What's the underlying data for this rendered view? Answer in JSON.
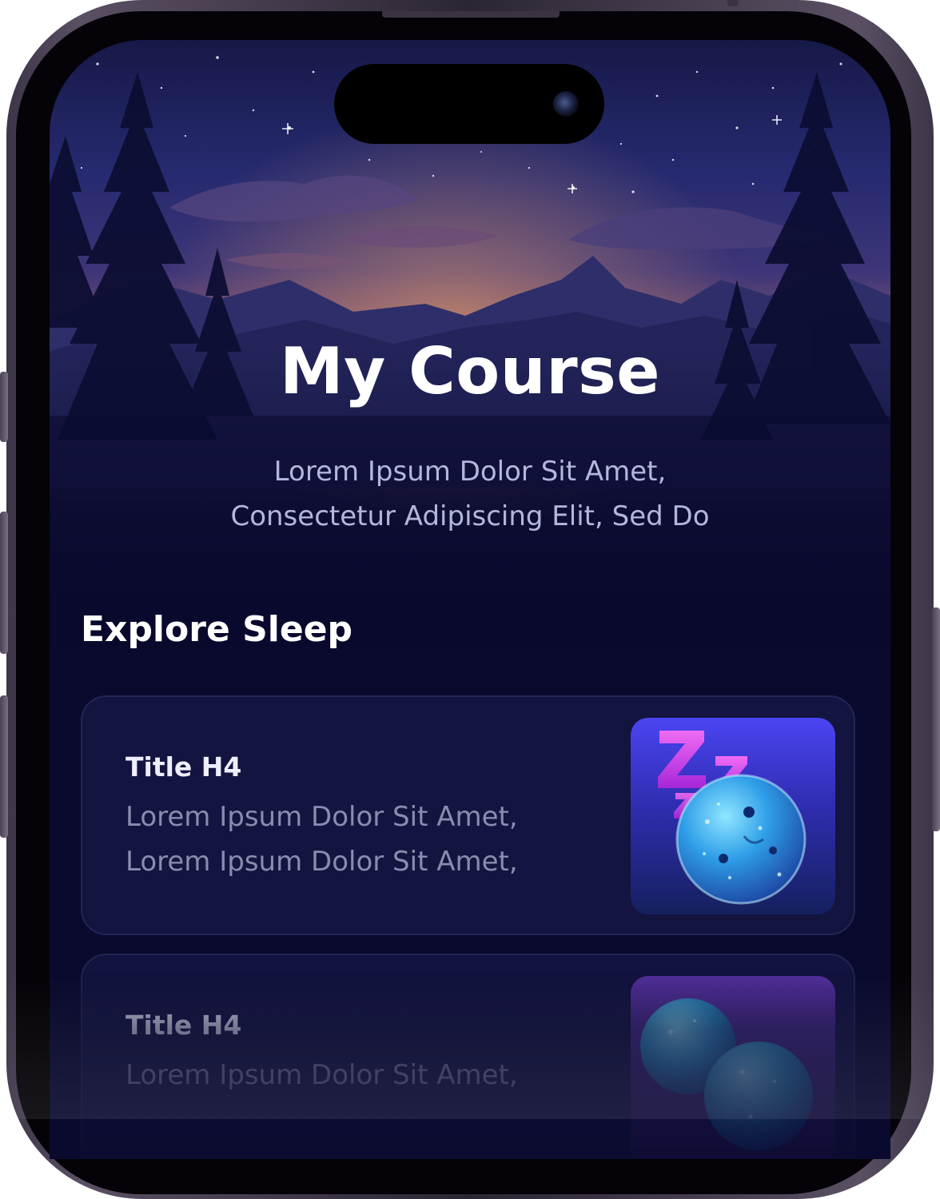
{
  "hero": {
    "title": "My Course",
    "subtitle_line1": "Lorem Ipsum Dolor Sit Amet,",
    "subtitle_line2": "Consectetur Adipiscing Elit, Sed Do"
  },
  "section": {
    "title": "Explore Sleep"
  },
  "cards": [
    {
      "title": "Title H4",
      "line1": "Lorem Ipsum Dolor Sit Amet,",
      "line2": "Lorem Ipsum Dolor Sit Amet,",
      "thumbnail_icon": "sleep-moon-zzz-icon"
    },
    {
      "title": "Title H4",
      "line1": "Lorem Ipsum Dolor Sit Amet,",
      "thumbnail_icon": "two-moons-icon"
    }
  ],
  "colors": {
    "background": "#0a0a2e",
    "card": "#13143f",
    "title_text": "#ffffff",
    "subtitle_text": "#b4b6dc",
    "card_body_text": "#8a8cae",
    "zzz_accent": "#d24cf0",
    "moon_accent": "#4fc3f7"
  }
}
